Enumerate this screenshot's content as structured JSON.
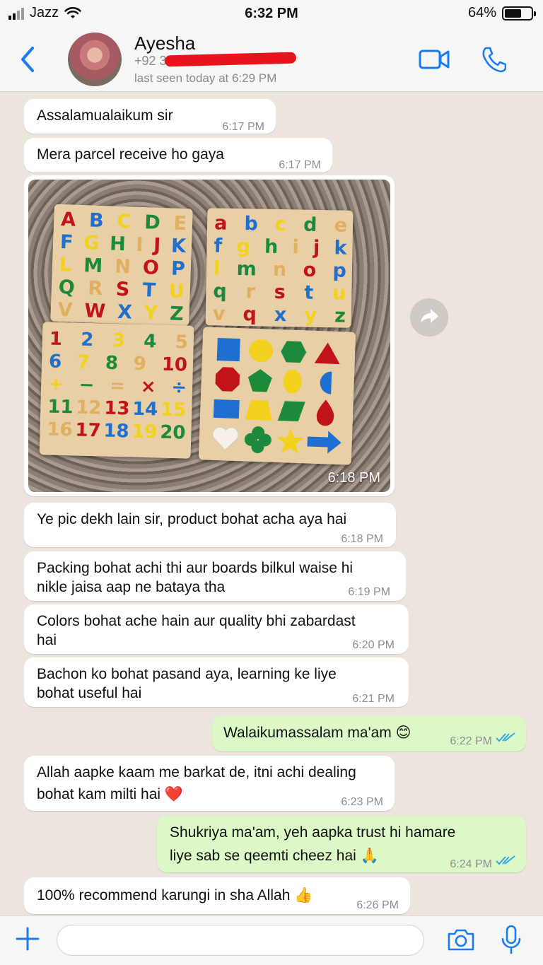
{
  "status_bar": {
    "carrier": "Jazz",
    "time": "6:32 PM",
    "battery": "64%",
    "battery_level": 0.64,
    "icons": [
      "signal-icon",
      "wifi-icon",
      "battery-icon"
    ]
  },
  "header": {
    "contact_name": "Ayesha",
    "phone": "+92 3",
    "last_seen": "last seen today at 6:29 PM",
    "icons": [
      "back-chevron-icon",
      "video-call-icon",
      "phone-call-icon"
    ]
  },
  "photo": {
    "time": "6:18 PM",
    "uppercase_rows": [
      [
        "A",
        "B",
        "C",
        "D",
        "E"
      ],
      [
        "F",
        "G",
        "H",
        "I",
        "J",
        "K"
      ],
      [
        "L",
        "M",
        "N",
        "O",
        "P"
      ],
      [
        "Q",
        "R",
        "S",
        "T",
        "U"
      ],
      [
        "V",
        "W",
        "X",
        "Y",
        "Z"
      ]
    ],
    "lowercase_rows": [
      [
        "a",
        "b",
        "c",
        "d",
        "e"
      ],
      [
        "f",
        "g",
        "h",
        "i",
        "j",
        "k"
      ],
      [
        "l",
        "m",
        "n",
        "o",
        "p"
      ],
      [
        "q",
        "r",
        "s",
        "t",
        "u"
      ],
      [
        "v",
        "q",
        "x",
        "y",
        "z"
      ]
    ],
    "number_rows": [
      [
        "1",
        "2",
        "3",
        "4",
        "5"
      ],
      [
        "6",
        "7",
        "8",
        "9",
        "10"
      ],
      [
        "+",
        "−",
        "=",
        "×",
        "÷"
      ],
      [
        "11",
        "12",
        "13",
        "14",
        "15"
      ],
      [
        "16",
        "17",
        "18",
        "19",
        "20"
      ]
    ]
  },
  "messages": [
    {
      "text": "Assalamualaikum sir",
      "time": "6:17 PM"
    },
    {
      "text": "Mera parcel receive ho gaya",
      "time": "6:17 PM"
    },
    {
      "text": "Ye pic dekh lain sir, product bohat acha aya hai",
      "time": "6:18 PM"
    },
    {
      "line1": "Packing bohat achi thi aur boards bilkul waise hi",
      "line2": "nikle jaisa aap ne bataya tha",
      "time": "6:19 PM"
    },
    {
      "line1": "Colors bohat ache hain aur quality bhi zabardast",
      "line2": "hai",
      "time": "6:20 PM"
    },
    {
      "line1": "Bachon ko bohat pasand aya, learning ke liye",
      "line2": "bohat useful hai",
      "time": "6:21 PM"
    },
    {
      "text": "Walaikumassalam ma'am 😊",
      "time": "6:22 PM"
    },
    {
      "line1": "Allah aapke kaam me barkat de, itni achi dealing",
      "line2": "bohat kam milti hai ❤️",
      "time": "6:23 PM"
    },
    {
      "line1": "Shukriya ma'am, yeh aapka trust hi hamare",
      "line2": "liye sab se qeemti cheez hai 🙏",
      "time": "6:24 PM"
    },
    {
      "text": "100% recommend karungi in sha Allah 👍",
      "time": "6:26 PM"
    }
  ],
  "input_bar": {
    "placeholder": "",
    "icons": [
      "plus-icon",
      "camera-icon",
      "microphone-icon"
    ]
  }
}
